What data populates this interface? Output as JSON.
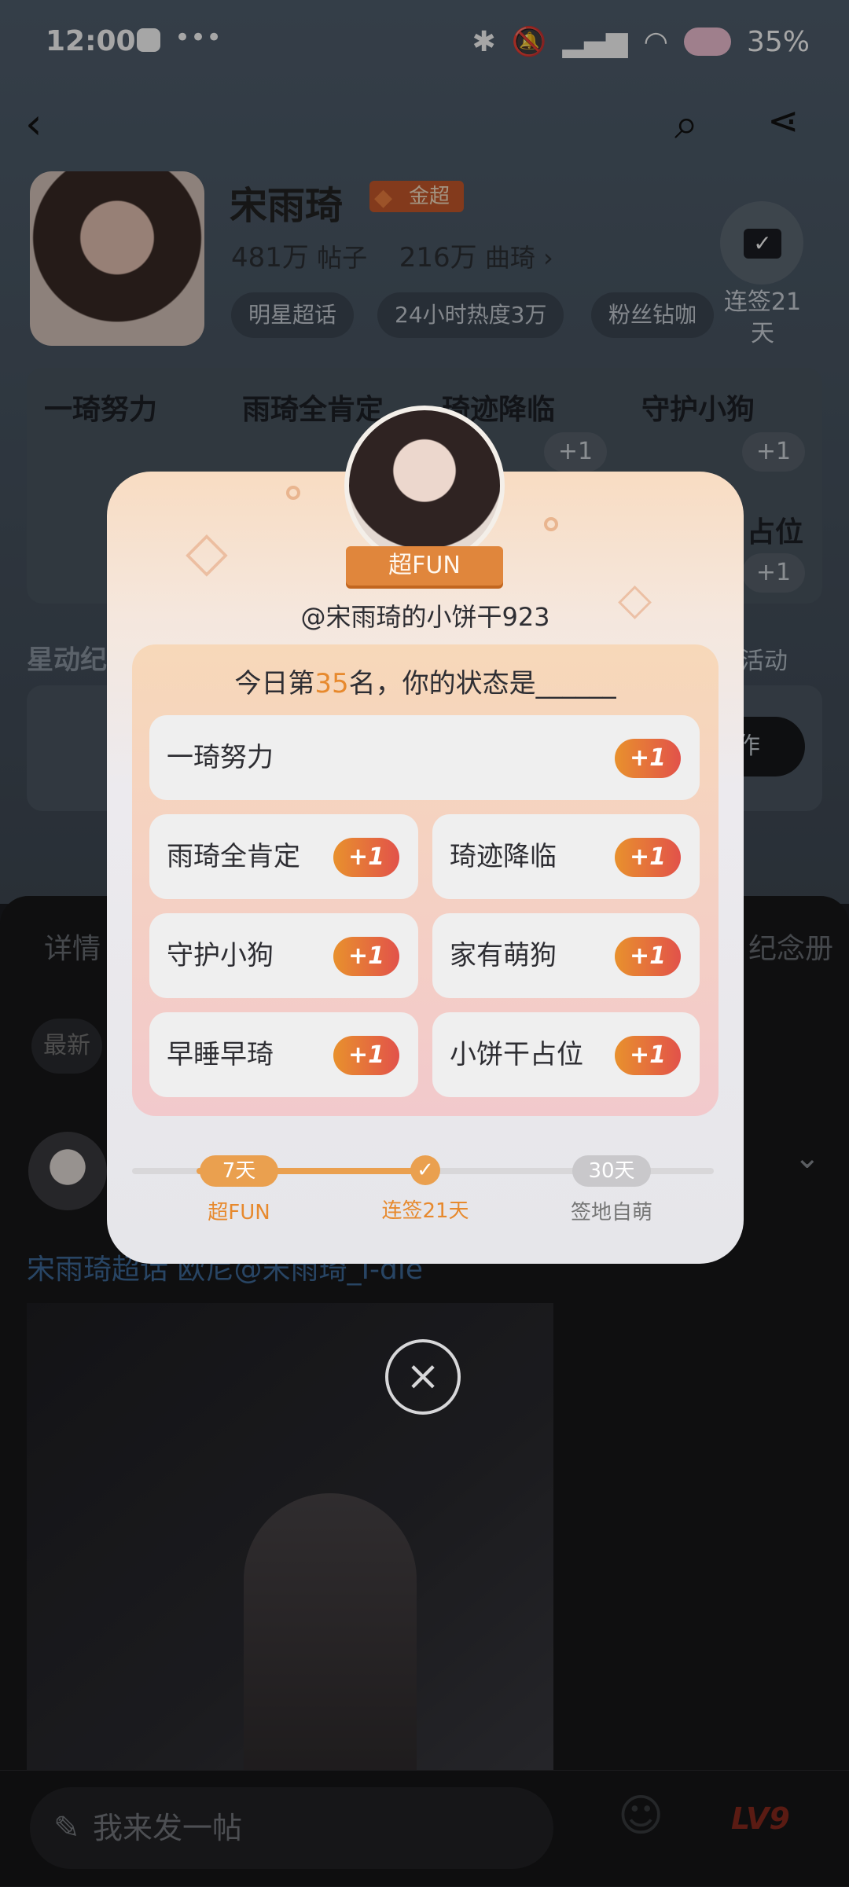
{
  "status_bar": {
    "time": "12:00",
    "battery": "35%"
  },
  "profile": {
    "name": "宋雨琦",
    "badge": "金超",
    "posts_count": "481万",
    "posts_label": "帖子",
    "fans_count": "216万",
    "fans_label": "曲琦",
    "tags": [
      "明星超话",
      "24小时热度3万",
      "粉丝钻咖"
    ],
    "checkin_label": "连签21天"
  },
  "hot_items": [
    {
      "label": "一琦努力"
    },
    {
      "label": "雨琦全肯定"
    },
    {
      "label": "琦迹降临"
    },
    {
      "label": "守护小狗"
    },
    {
      "label": "占位"
    }
  ],
  "hot_plus": "+1",
  "section": {
    "title": "星动纪",
    "activity_link": "活动",
    "create_label": "作"
  },
  "tabs": {
    "left": "详情",
    "right": "纪念册",
    "filter": "最新"
  },
  "post": {
    "caption": "宋雨琦超话 欧尼@宋雨琦_I-dle"
  },
  "modal": {
    "rank_title": "超FUN",
    "username": "@宋雨琦的小饼干923",
    "status_prefix": "今日第",
    "rank_number": "35",
    "status_suffix": "名，你的状态是______",
    "options": [
      {
        "label": "一琦努力",
        "plus": "+1"
      },
      {
        "label": "雨琦全肯定",
        "plus": "+1"
      },
      {
        "label": "琦迹降临",
        "plus": "+1"
      },
      {
        "label": "守护小狗",
        "plus": "+1"
      },
      {
        "label": "家有萌狗",
        "plus": "+1"
      },
      {
        "label": "早睡早琦",
        "plus": "+1"
      },
      {
        "label": "小饼干占位",
        "plus": "+1"
      }
    ],
    "progress": {
      "milestones": [
        {
          "days": "7天",
          "label": "超FUN"
        },
        {
          "days": "",
          "label": "连签21天"
        },
        {
          "days": "30天",
          "label": "签地自萌"
        }
      ]
    }
  },
  "compose": {
    "placeholder": "我来发一帖"
  },
  "bottom_nav": {
    "level_badge": "LV9"
  }
}
